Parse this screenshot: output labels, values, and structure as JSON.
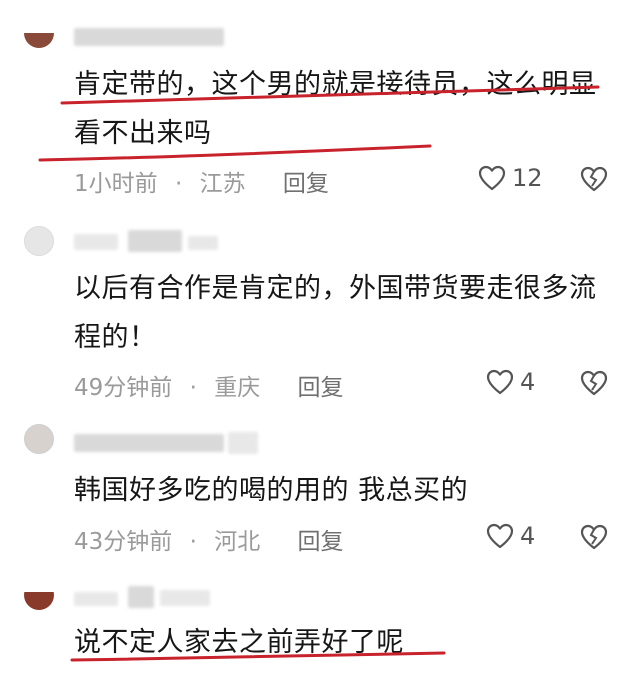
{
  "comments": [
    {
      "text": "肯定带的，这个男的就是接待员，这么明显看不出来吗",
      "time": "1小时前",
      "location": "江苏",
      "reply_label": "回复",
      "likes": "12",
      "avatar_color": "#8a4a3a"
    },
    {
      "text": "以后有合作是肯定的，外国带货要走很多流程的！",
      "time": "49分钟前",
      "location": "重庆",
      "reply_label": "回复",
      "likes": "4",
      "avatar_color": "#e0e0e0"
    },
    {
      "text": "韩国好多吃的喝的用的 我总买的",
      "time": "43分钟前",
      "location": "河北",
      "reply_label": "回复",
      "likes": "4",
      "avatar_color": "#d8d2cf"
    },
    {
      "text": "说不定人家去之前弄好了呢",
      "avatar_color": "#8a3a2a"
    }
  ],
  "separator": "·",
  "annotation_color": "#c8232c"
}
